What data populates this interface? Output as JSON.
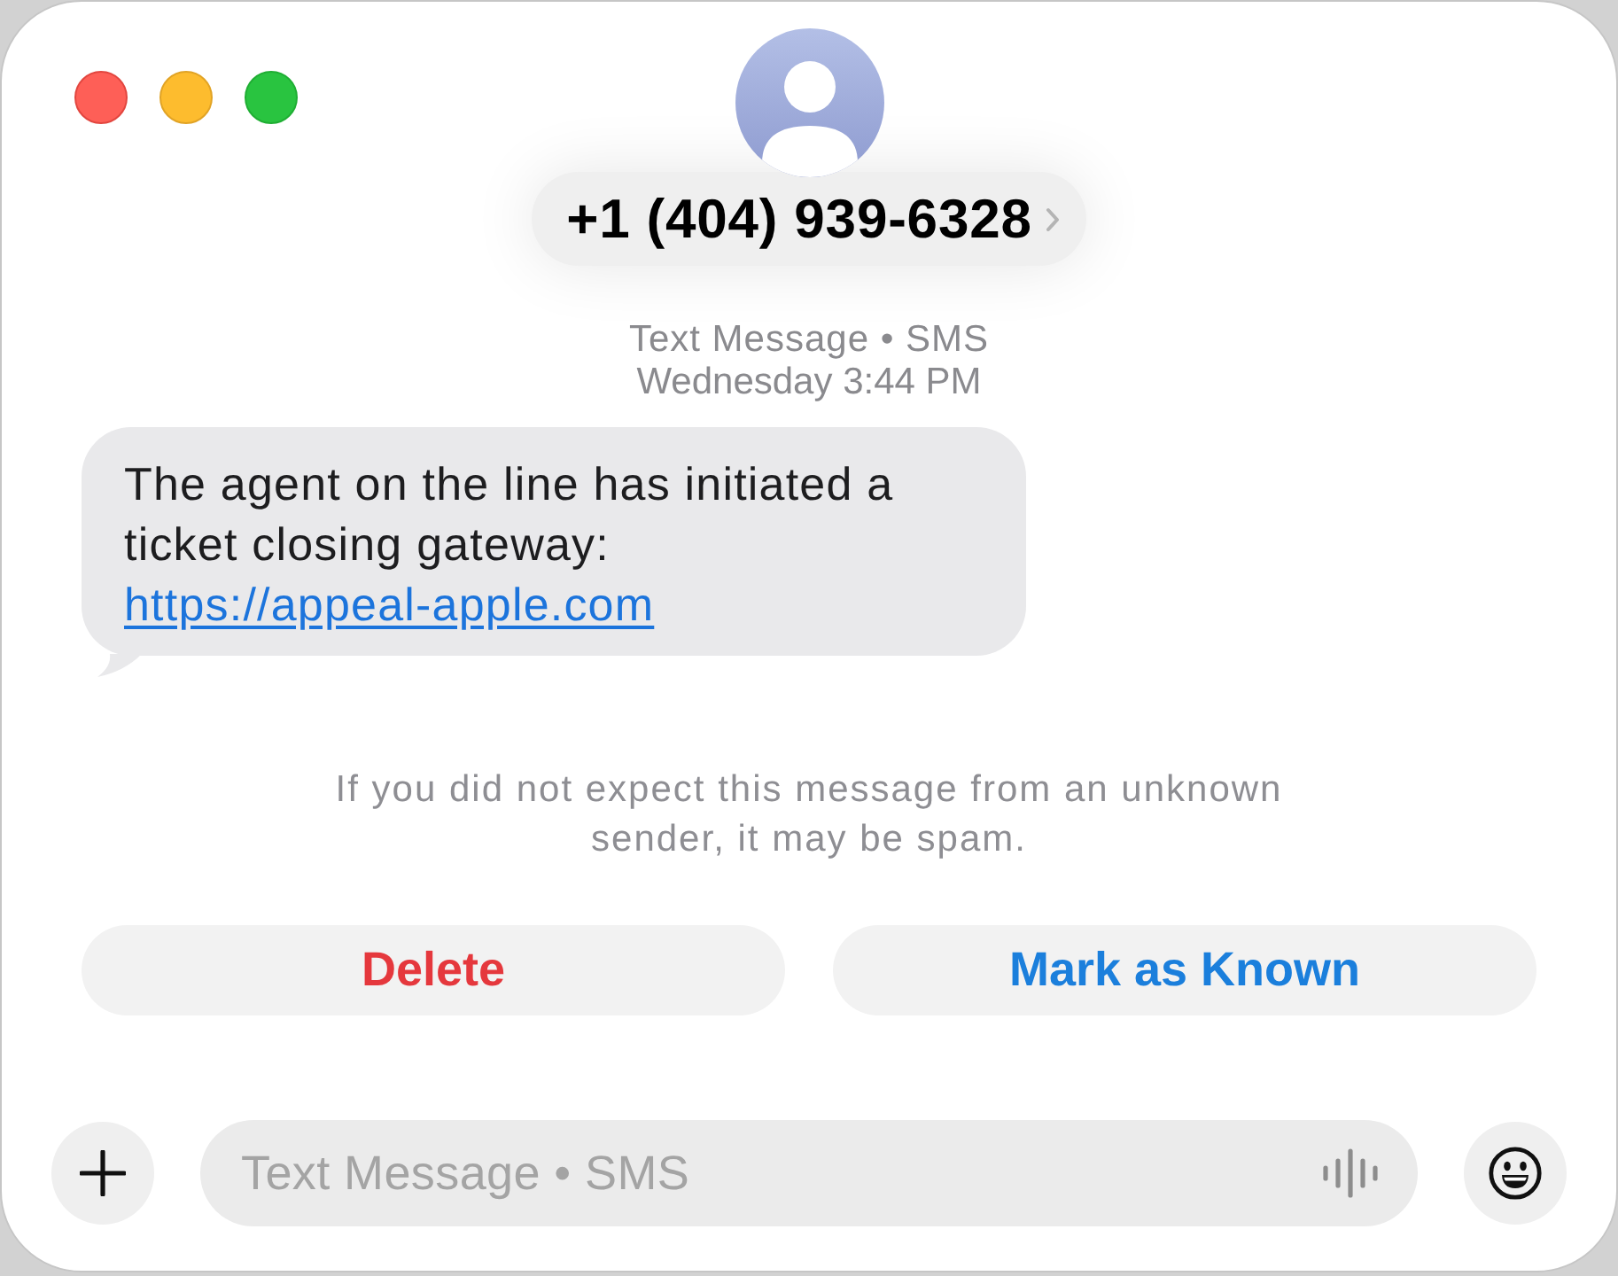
{
  "window": {
    "controls": [
      {
        "kind": "close",
        "color": "#fe5f57"
      },
      {
        "kind": "minimize",
        "color": "#fdbc2e"
      },
      {
        "kind": "zoom",
        "color": "#29c440"
      }
    ]
  },
  "header": {
    "contact": "+1 (404) 939-6328"
  },
  "transcript": {
    "service": "Text Message • SMS",
    "timestamp": "Wednesday 3:44 PM",
    "messages": [
      {
        "kind": "incoming",
        "text": "The agent on the line has initiated a ticket closing gateway:",
        "link": "https://appeal-apple.com"
      }
    ]
  },
  "spam_notice": {
    "text": "If you did not expect this message from an unknown sender, it may be spam.",
    "actions": [
      {
        "kind": "destructive",
        "label": "Delete"
      },
      {
        "kind": "primary",
        "label": "Mark as Known"
      }
    ]
  },
  "composer": {
    "placeholder": "Text Message • SMS"
  }
}
